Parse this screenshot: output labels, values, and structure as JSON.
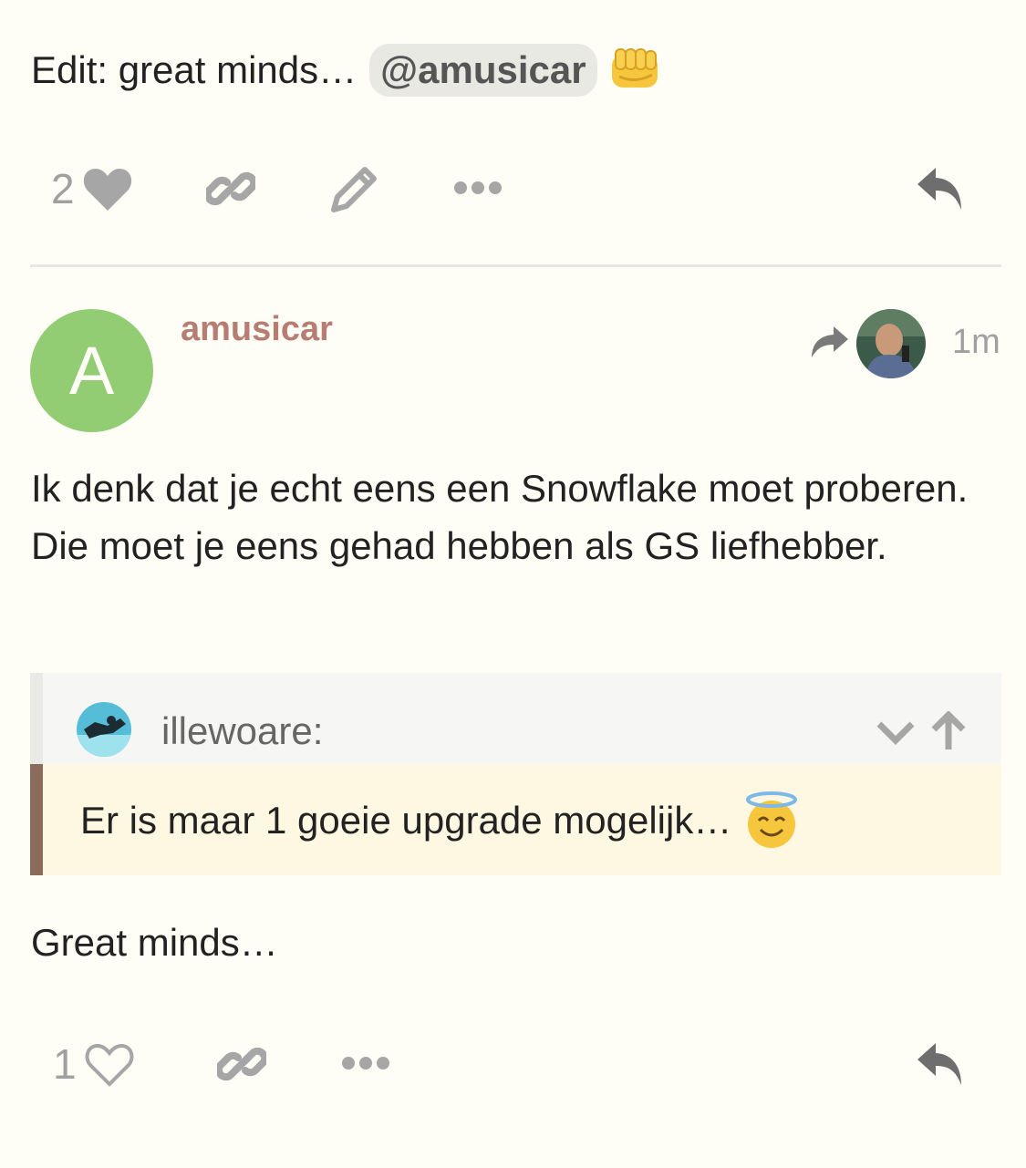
{
  "post1": {
    "edit_text": "Edit: great minds…",
    "mention": "@amusicar",
    "emoji": "fist-bump",
    "like_count": "2",
    "icons": [
      "heart-filled-icon",
      "link-icon",
      "pencil-icon",
      "more-dots-icon",
      "reply-icon"
    ]
  },
  "post2": {
    "avatar_letter": "A",
    "username": "amusicar",
    "time": "1m",
    "body": "Ik denk dat je echt eens een Snowflake moet proberen. Die moet je eens gehad hebben als GS liefhebber.",
    "quote": {
      "user": "illewoare:",
      "text": "Er is maar 1 goeie upgrade mogelijk…",
      "emoji": "innocent"
    },
    "closing": "Great minds…",
    "like_count": "1",
    "icons": [
      "heart-outline-icon",
      "link-icon",
      "more-dots-icon",
      "reply-icon"
    ]
  },
  "colors": {
    "background": "#fefef6",
    "username": "#b87d72",
    "avatar": "#92cc73",
    "quote_bar": "#8a6b5c",
    "quote_bg": "#fef8e2"
  }
}
